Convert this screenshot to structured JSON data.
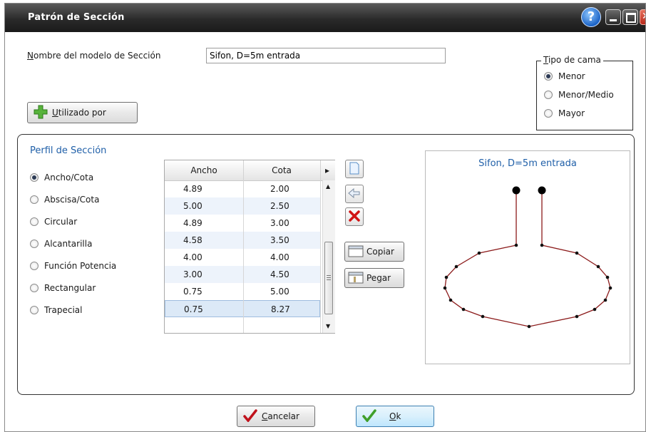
{
  "window": {
    "title": "Patrón de Sección"
  },
  "section_name": {
    "label": "Nombre del modelo de Sección",
    "value": "Sifon, D=5m entrada"
  },
  "bed_type": {
    "legend": "Tipo de cama",
    "options": [
      {
        "label": "Menor",
        "selected": true
      },
      {
        "label": "Menor/Medio",
        "selected": false
      },
      {
        "label": "Mayor",
        "selected": false
      }
    ]
  },
  "used_by_button": {
    "label": "Utilizado por"
  },
  "profile": {
    "title": "Perfil de Sección",
    "options": [
      {
        "label": "Ancho/Cota",
        "selected": true
      },
      {
        "label": "Abscisa/Cota",
        "selected": false
      },
      {
        "label": "Circular",
        "selected": false
      },
      {
        "label": "Alcantarilla",
        "selected": false
      },
      {
        "label": "Función Potencia",
        "selected": false
      },
      {
        "label": "Rectangular",
        "selected": false
      },
      {
        "label": "Trapecial",
        "selected": false
      }
    ]
  },
  "table": {
    "columns": [
      "Ancho",
      "Cota"
    ],
    "rows": [
      [
        "4.89",
        "2.00"
      ],
      [
        "5.00",
        "2.50"
      ],
      [
        "4.89",
        "3.00"
      ],
      [
        "4.58",
        "3.50"
      ],
      [
        "4.00",
        "4.00"
      ],
      [
        "3.00",
        "4.50"
      ],
      [
        "0.75",
        "5.00"
      ],
      [
        "0.75",
        "8.27"
      ]
    ],
    "selected_row": 7
  },
  "tools": {
    "copy_label": "Copiar",
    "paste_label": "Pegar"
  },
  "preview": {
    "title": "Sifon, D=5m entrada"
  },
  "footer": {
    "cancel_label": "Cancelar",
    "ok_label": "Ok"
  },
  "colors": {
    "title_blue": "#1f5fa8",
    "profile_line": "#8b1a1a",
    "titlebar": "#2a2a2a"
  }
}
